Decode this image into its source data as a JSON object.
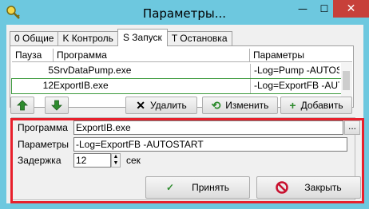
{
  "window": {
    "title": "Параметры...",
    "close_symbol": "✕",
    "min_symbol": "—",
    "max_symbol": "☐"
  },
  "tabs": [
    {
      "label": "0 Общие"
    },
    {
      "label": "K Контроль"
    },
    {
      "label": "S Запуск"
    },
    {
      "label": "T Остановка"
    }
  ],
  "grid": {
    "columns": [
      "Пауза",
      "Программа",
      "Параметры"
    ],
    "rows": [
      {
        "pause": "5",
        "program": "SrvDataPump.exe",
        "params": "-Log=Pump -AUTOSTART"
      },
      {
        "pause": "12",
        "program": "ExportIB.exe",
        "params": "-Log=ExportFB -AUTOSTART"
      }
    ]
  },
  "toolbar": {
    "up_icon": "up-arrow-icon",
    "down_icon": "down-arrow-icon",
    "delete_label": "Удалить",
    "edit_label": "Изменить",
    "add_label": "Добавить"
  },
  "form": {
    "program_label": "Программа",
    "program_value": "ExportIB.exe",
    "browse_label": "...",
    "params_label": "Параметры",
    "params_value": "-Log=ExportFB -AUTOSTART",
    "delay_label": "Задержка",
    "delay_value": "12",
    "delay_unit": "сек"
  },
  "buttons": {
    "apply_label": "Принять",
    "close_label": "Закрыть"
  },
  "colors": {
    "accent_green": "#2e8b2e",
    "highlight": "#e8202c",
    "titlebar": "#6dc8df",
    "close_red": "#c7403a"
  }
}
